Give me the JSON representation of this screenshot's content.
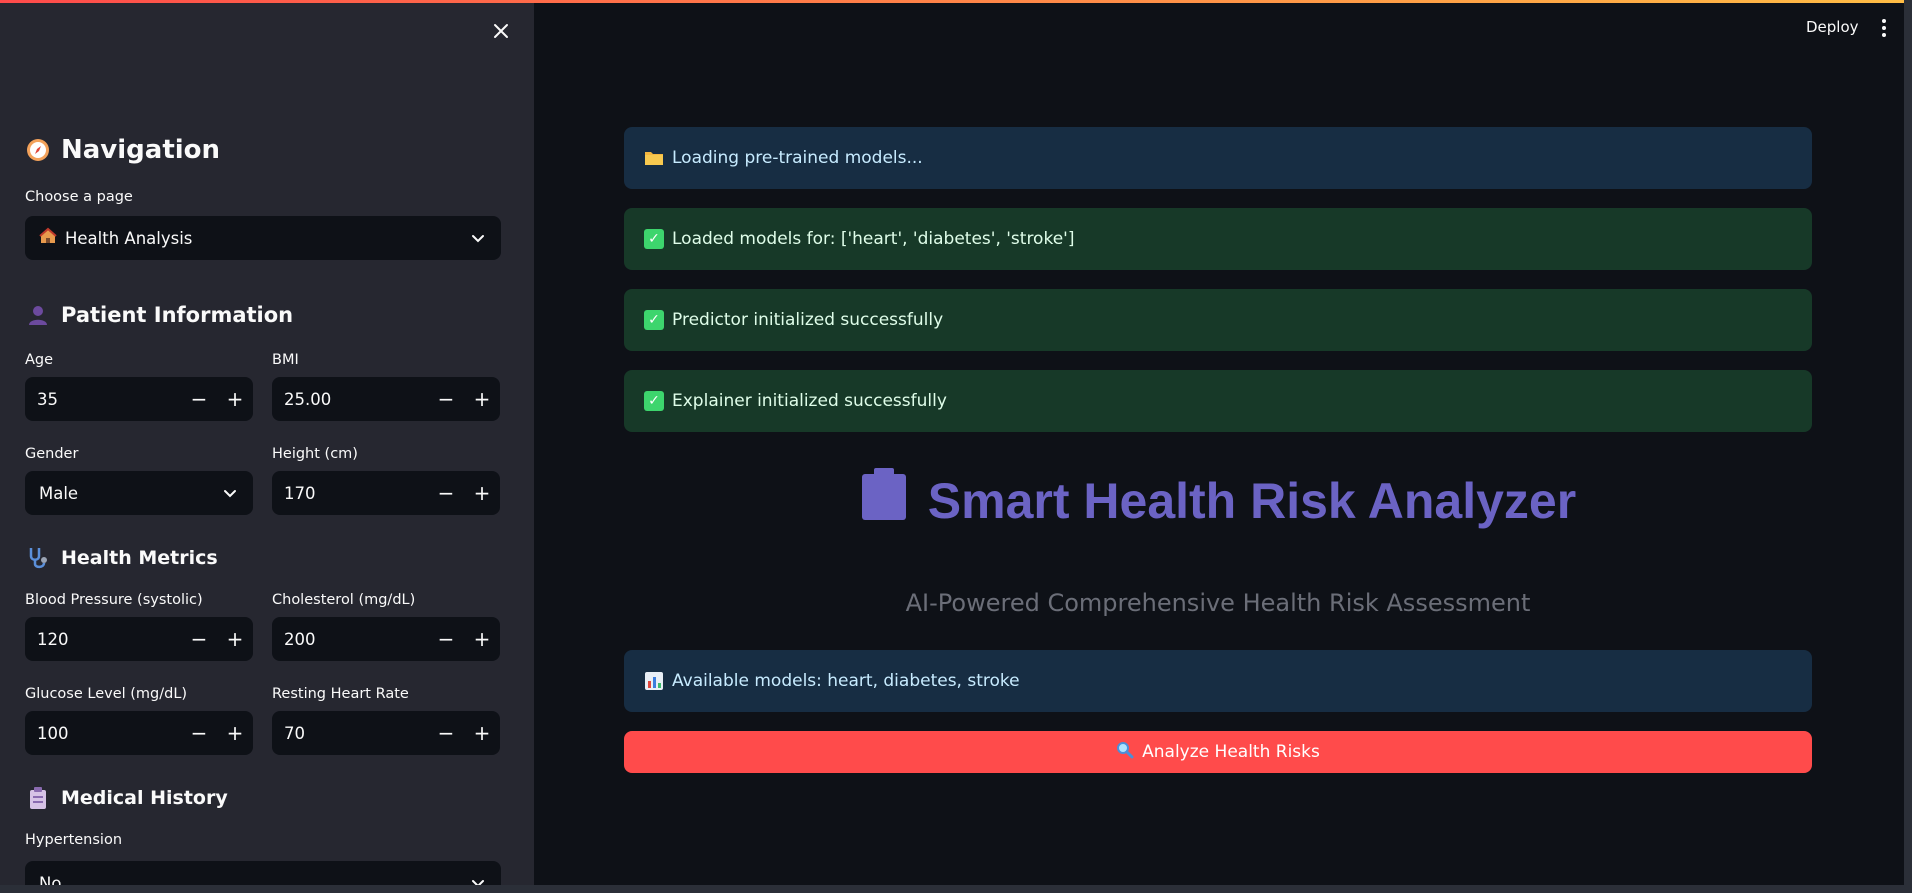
{
  "header": {
    "deploy_label": "Deploy"
  },
  "sidebar": {
    "navigation_title": "Navigation",
    "page_select_label": "Choose a page",
    "page_select_value": "Health Analysis",
    "patient_title": "Patient Information",
    "age_label": "Age",
    "age_value": "35",
    "bmi_label": "BMI",
    "bmi_value": "25.00",
    "gender_label": "Gender",
    "gender_value": "Male",
    "height_label": "Height (cm)",
    "height_value": "170",
    "metrics_title": "Health Metrics",
    "bp_label": "Blood Pressure (systolic)",
    "bp_value": "120",
    "chol_label": "Cholesterol (mg/dL)",
    "chol_value": "200",
    "glucose_label": "Glucose Level (mg/dL)",
    "glucose_value": "100",
    "hr_label": "Resting Heart Rate",
    "hr_value": "70",
    "history_title": "Medical History",
    "hypertension_label": "Hypertension",
    "hypertension_value": "No"
  },
  "main": {
    "alerts": [
      {
        "type": "info",
        "text": "Loading pre-trained models..."
      },
      {
        "type": "success",
        "text": "Loaded models for: ['heart', 'diabetes', 'stroke']"
      },
      {
        "type": "success",
        "text": "Predictor initialized successfully"
      },
      {
        "type": "success",
        "text": "Explainer initialized successfully"
      }
    ],
    "title": "Smart Health Risk Analyzer",
    "subtitle": "AI-Powered Comprehensive Health Risk Assessment",
    "models_info": "Available models: heart, diabetes, stroke",
    "analyze_label": "Analyze Health Risks"
  },
  "colors": {
    "accent": "#ff4b4b",
    "title": "#6b63c4",
    "info_bg": "#172d43",
    "success_bg": "#173928"
  }
}
